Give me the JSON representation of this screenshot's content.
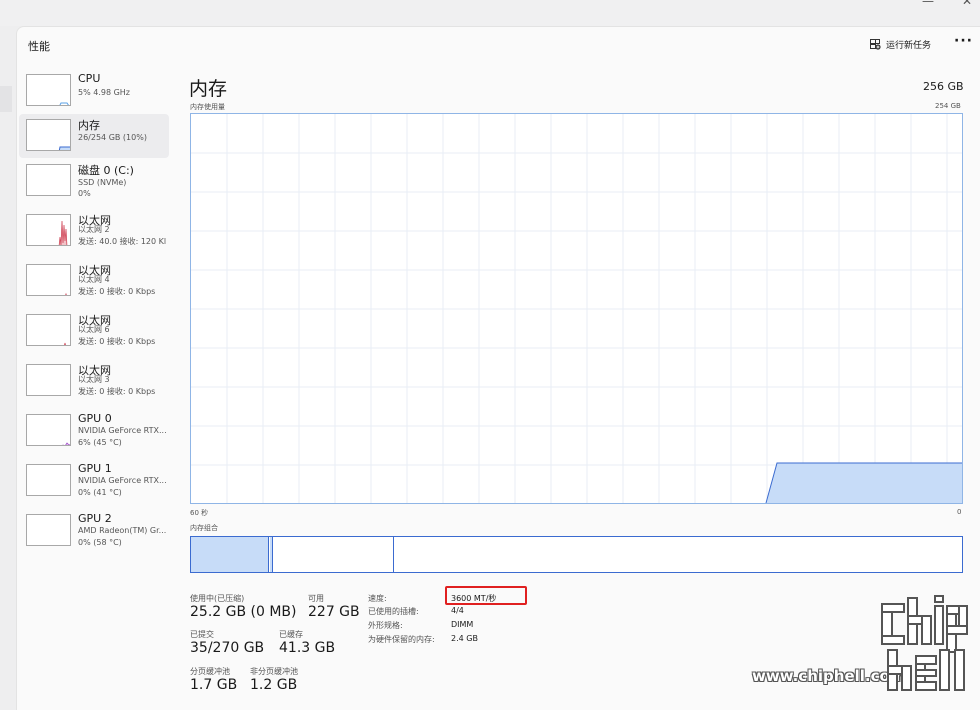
{
  "header": {
    "title": "性能",
    "run_task_label": "运行新任务",
    "more_label": "···"
  },
  "sidebar": {
    "items": [
      {
        "name": "CPU",
        "sub1": "5% 4.98 GHz",
        "sub2": ""
      },
      {
        "name": "内存",
        "sub1": "26/254 GB (10%)",
        "sub2": ""
      },
      {
        "name": "磁盘 0 (C:)",
        "sub1": "SSD (NVMe)",
        "sub2": "0%"
      },
      {
        "name": "以太网",
        "sub1": "以太网 2",
        "sub2": "发送: 40.0 接收: 120 Kl"
      },
      {
        "name": "以太网",
        "sub1": "以太网 4",
        "sub2": "发送: 0 接收: 0 Kbps"
      },
      {
        "name": "以太网",
        "sub1": "以太网 6",
        "sub2": "发送: 0 接收: 0 Kbps"
      },
      {
        "name": "以太网",
        "sub1": "以太网 3",
        "sub2": "发送: 0 接收: 0 Kbps"
      },
      {
        "name": "GPU 0",
        "sub1": "NVIDIA GeForce RTX...",
        "sub2": "6% (45 °C)"
      },
      {
        "name": "GPU 1",
        "sub1": "NVIDIA GeForce RTX...",
        "sub2": "0% (41 °C)"
      },
      {
        "name": "GPU 2",
        "sub1": "AMD Radeon(TM) Gr...",
        "sub2": "0% (58 °C)"
      }
    ]
  },
  "main": {
    "title": "内存",
    "total": "256 GB",
    "usage_label": "内存使用量",
    "usage_max": "254 GB",
    "time_left": "60 秒",
    "time_right": "0",
    "composition_label": "内存组合"
  },
  "stats": {
    "in_use_label": "使用中(已压缩)",
    "in_use_value": "25.2 GB (0 MB)",
    "available_label": "可用",
    "available_value": "227 GB",
    "committed_label": "已提交",
    "committed_value": "35/270 GB",
    "cached_label": "已缓存",
    "cached_value": "41.3 GB",
    "paged_label": "分页缓冲池",
    "paged_value": "1.7 GB",
    "nonpaged_label": "非分页缓冲池",
    "nonpaged_value": "1.2 GB"
  },
  "specs": {
    "speed_label": "速度:",
    "speed_value": "3600 MT/秒",
    "slots_label": "已使用的插槽:",
    "slots_value": "4/4",
    "form_label": "外形规格:",
    "form_value": "DIMM",
    "reserved_label": "为硬件保留的内存:",
    "reserved_value": "2.4 GB"
  },
  "watermark": {
    "text": "www.chiphell.com"
  },
  "colors": {
    "accent": "#3b6bd0",
    "fill": "#c7dcf8",
    "grid": "#e9eef5",
    "highlight": "#e02020"
  }
}
